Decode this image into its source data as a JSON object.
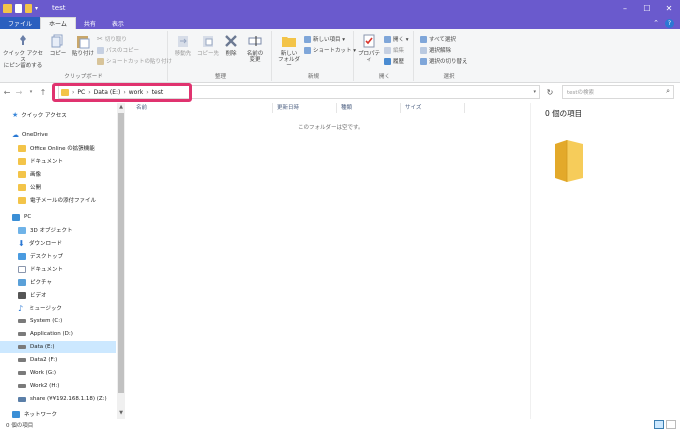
{
  "window": {
    "title": "test",
    "minimize": "–",
    "maximize": "☐",
    "close": "✕"
  },
  "ribbon_tabs": {
    "file": "ファイル",
    "home": "ホーム",
    "share": "共有",
    "view": "表示"
  },
  "ribbon": {
    "pin_quick_access": "クイック アクセス\nにピン留めする",
    "copy": "コピー",
    "paste": "貼り付け",
    "cut": "切り取り",
    "copy_path": "パスのコピー",
    "paste_shortcut": "ショートカットの貼り付け",
    "group_clipboard": "クリップボード",
    "move_to": "移動先",
    "copy_to": "コピー先",
    "delete": "削除",
    "rename": "名前の\n変更",
    "group_organize": "整理",
    "new_folder": "新しい\nフォルダー",
    "new_item": "新しい項目 ▾",
    "shortcut": "ショートカット ▾",
    "group_new": "新規",
    "properties": "プロパティ",
    "open": "開く ▾",
    "edit": "編集",
    "history": "履歴",
    "group_open": "開く",
    "select_all": "すべて選択",
    "select_none": "選択解除",
    "invert_selection": "選択の切り替え",
    "group_select": "選択"
  },
  "address": {
    "crumbs": [
      "PC",
      "Data (E:)",
      "work",
      "test"
    ],
    "search_placeholder": "testの検索"
  },
  "sidebar": {
    "items": [
      {
        "label": "クイック アクセス",
        "icon": "star-icon"
      },
      {
        "label": "OneDrive",
        "icon": "cloud-icon"
      },
      {
        "label": "Office Online の拡張機能",
        "icon": "folder-icon"
      },
      {
        "label": "ドキュメント",
        "icon": "folder-icon"
      },
      {
        "label": "画像",
        "icon": "folder-icon"
      },
      {
        "label": "公開",
        "icon": "folder-icon"
      },
      {
        "label": "電子メールの添付ファイル",
        "icon": "folder-icon"
      },
      {
        "label": "PC",
        "icon": "pc-icon"
      },
      {
        "label": "3D オブジェクト",
        "icon": "cube-icon"
      },
      {
        "label": "ダウンロード",
        "icon": "download-icon"
      },
      {
        "label": "デスクトップ",
        "icon": "desktop-icon"
      },
      {
        "label": "ドキュメント",
        "icon": "document-icon"
      },
      {
        "label": "ピクチャ",
        "icon": "picture-icon"
      },
      {
        "label": "ビデオ",
        "icon": "video-icon"
      },
      {
        "label": "ミュージック",
        "icon": "music-icon"
      },
      {
        "label": "System (C:)",
        "icon": "drive-icon"
      },
      {
        "label": "Application (D:)",
        "icon": "drive-icon"
      },
      {
        "label": "Data (E:)",
        "icon": "drive-icon"
      },
      {
        "label": "Data2 (F:)",
        "icon": "drive-icon"
      },
      {
        "label": "Work (G:)",
        "icon": "drive-icon"
      },
      {
        "label": "Work2 (H:)",
        "icon": "drive-icon"
      },
      {
        "label": "share (¥¥192.168.1.18) (Z:)",
        "icon": "network-drive-icon"
      },
      {
        "label": "ネットワーク",
        "icon": "network-icon"
      }
    ],
    "selected": "Data (E:)"
  },
  "columns": {
    "name": "名前",
    "date": "更新日時",
    "type": "種類",
    "size": "サイズ"
  },
  "empty_message": "このフォルダーは空です。",
  "preview": {
    "count": "0 個の項目"
  },
  "status": {
    "items": "0 個の項目"
  }
}
